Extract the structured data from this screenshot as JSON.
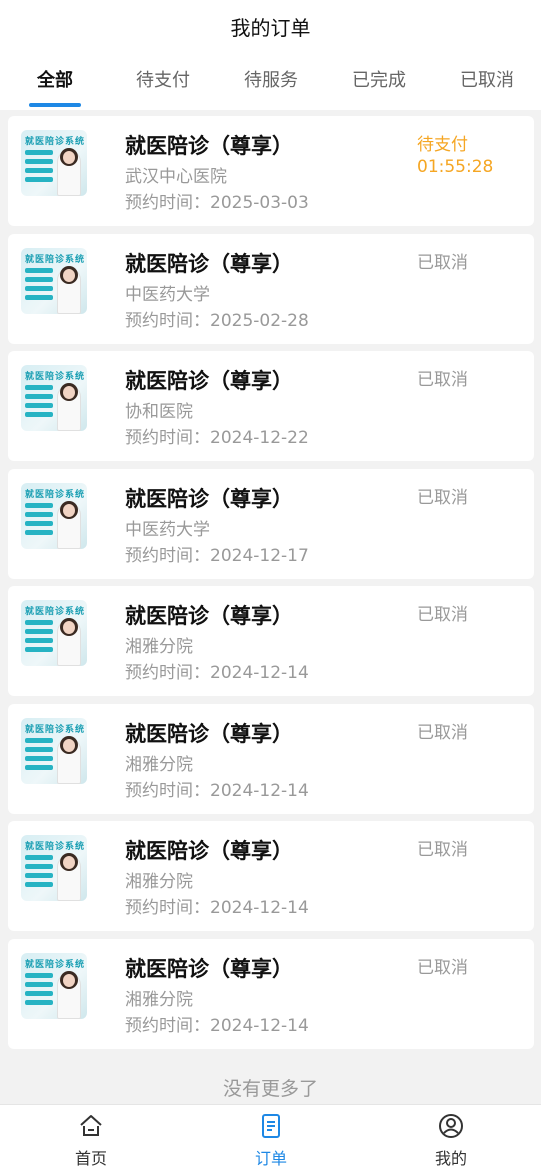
{
  "header": {
    "title": "我的订单"
  },
  "tabs": [
    {
      "label": "全部",
      "active": true
    },
    {
      "label": "待支付"
    },
    {
      "label": "待服务"
    },
    {
      "label": "已完成"
    },
    {
      "label": "已取消"
    }
  ],
  "thumbnail_text": "就医陪诊系统",
  "orders": [
    {
      "title": "就医陪诊（尊享）",
      "hospital": "武汉中心医院",
      "time": "预约时间：2025-03-03",
      "status": "待支付",
      "countdown": "01:55:28"
    },
    {
      "title": "就医陪诊（尊享）",
      "hospital": "中医药大学",
      "time": "预约时间：2025-02-28",
      "status": "已取消"
    },
    {
      "title": "就医陪诊（尊享）",
      "hospital": "协和医院",
      "time": "预约时间：2024-12-22",
      "status": "已取消"
    },
    {
      "title": "就医陪诊（尊享）",
      "hospital": "中医药大学",
      "time": "预约时间：2024-12-17",
      "status": "已取消"
    },
    {
      "title": "就医陪诊（尊享）",
      "hospital": "湘雅分院",
      "time": "预约时间：2024-12-14",
      "status": "已取消"
    },
    {
      "title": "就医陪诊（尊享）",
      "hospital": "湘雅分院",
      "time": "预约时间：2024-12-14",
      "status": "已取消"
    },
    {
      "title": "就医陪诊（尊享）",
      "hospital": "湘雅分院",
      "time": "预约时间：2024-12-14",
      "status": "已取消"
    },
    {
      "title": "就医陪诊（尊享）",
      "hospital": "湘雅分院",
      "time": "预约时间：2024-12-14",
      "status": "已取消"
    }
  ],
  "footer_text": "没有更多了",
  "tabbar": [
    {
      "label": "首页",
      "icon": "home-icon"
    },
    {
      "label": "订单",
      "icon": "order-icon",
      "active": true
    },
    {
      "label": "我的",
      "icon": "profile-icon"
    }
  ],
  "colors": {
    "accent": "#1e88e5",
    "pending": "#f5a623",
    "muted": "#999999"
  }
}
